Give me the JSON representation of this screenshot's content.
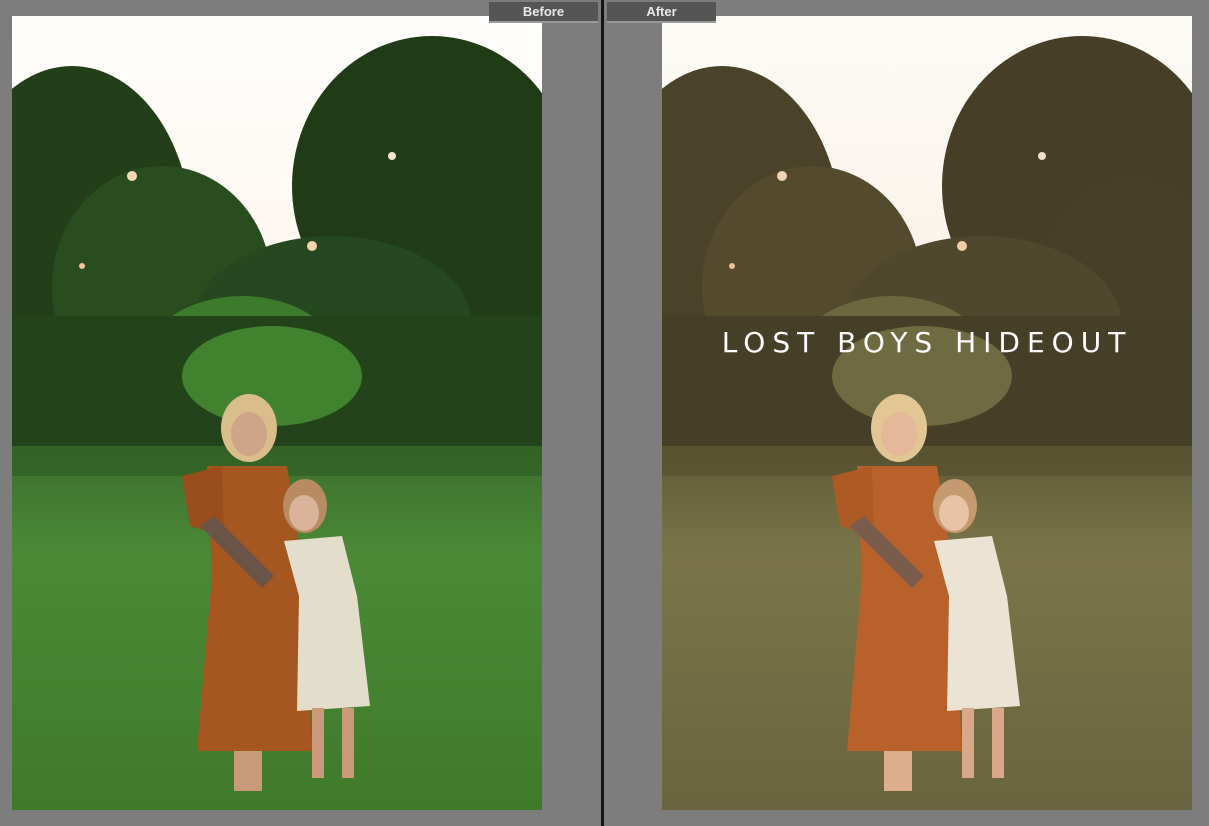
{
  "tabs": {
    "before_label": "Before",
    "after_label": "After"
  },
  "after_panel": {
    "watermark_text": "LOST BOYS HIDEOUT"
  },
  "colors": {
    "background": "#7d7d7d",
    "divider": "#141414",
    "tab_background": "#555555",
    "tab_text": "#e8e8e8",
    "before_grass": "#3e7a2c",
    "after_grass": "#6b6a3e",
    "dress_orange": "#a85a24",
    "child_dress": "#e4dcc8"
  },
  "icons": {
    "before_photo": "photo-before-image",
    "after_photo": "photo-after-image"
  }
}
